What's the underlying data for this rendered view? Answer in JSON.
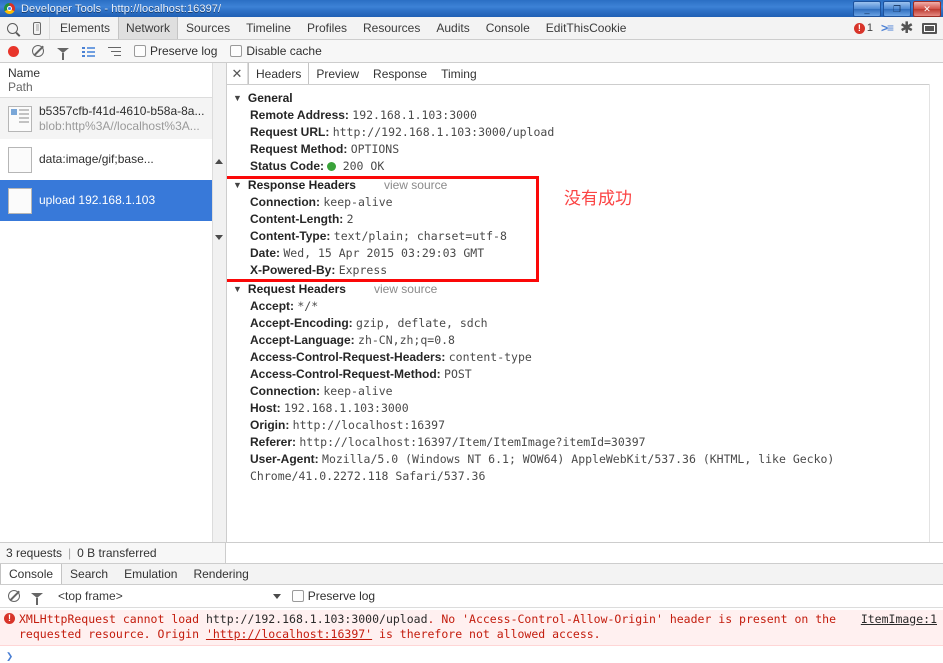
{
  "window": {
    "title": "Developer Tools - http://localhost:16397/",
    "minimize": "_",
    "maximize": "❐",
    "close": "✕"
  },
  "toolbar": {
    "search_icon": "search-icon",
    "device_icon": "device-toggle-icon",
    "panels": [
      {
        "label": "Elements",
        "selected": false
      },
      {
        "label": "Network",
        "selected": true
      },
      {
        "label": "Sources",
        "selected": false
      },
      {
        "label": "Timeline",
        "selected": false
      },
      {
        "label": "Profiles",
        "selected": false
      },
      {
        "label": "Resources",
        "selected": false
      },
      {
        "label": "Audits",
        "selected": false
      },
      {
        "label": "Console",
        "selected": false
      },
      {
        "label": "EditThisCookie",
        "selected": false
      }
    ],
    "error_count": "1",
    "drawer_toggle_icon": "console-drawer-icon",
    "settings_icon": "gear-icon",
    "dock_icon": "dock-position-icon"
  },
  "network_toolbar": {
    "record_label": "record-button",
    "clear_label": "clear-button",
    "filter_label": "filter-button",
    "large_rows_label": "use-large-rows-button",
    "group_label": "group-by-frame-button",
    "preserve_log": "Preserve log",
    "disable_cache": "Disable cache"
  },
  "request_list": {
    "header_name": "Name",
    "header_path": "Path",
    "rows": [
      {
        "name": "b5357cfb-f41d-4610-b58a-8a...",
        "path": "blob:http%3A//localhost%3A...",
        "selected": false
      },
      {
        "name": "data:image/gif;base...",
        "path": "",
        "selected": false
      },
      {
        "name": "upload",
        "path": "192.168.1.103",
        "selected": true
      }
    ]
  },
  "detail": {
    "close_label": "✕",
    "tabs": [
      {
        "label": "Headers",
        "selected": true
      },
      {
        "label": "Preview",
        "selected": false
      },
      {
        "label": "Response",
        "selected": false
      },
      {
        "label": "Timing",
        "selected": false
      }
    ],
    "sections": [
      {
        "title": "General",
        "view_source": "",
        "rows": [
          {
            "key": "Remote Address:",
            "value": "192.168.1.103:3000",
            "status": false
          },
          {
            "key": "Request URL:",
            "value": "http://192.168.1.103:3000/upload",
            "status": false
          },
          {
            "key": "Request Method:",
            "value": "OPTIONS",
            "status": false
          },
          {
            "key": "Status Code:",
            "value": "200 OK",
            "status": true
          }
        ]
      },
      {
        "title": "Response Headers",
        "view_source": "view source",
        "rows": [
          {
            "key": "Connection:",
            "value": "keep-alive",
            "status": false
          },
          {
            "key": "Content-Length:",
            "value": "2",
            "status": false
          },
          {
            "key": "Content-Type:",
            "value": "text/plain; charset=utf-8",
            "status": false
          },
          {
            "key": "Date:",
            "value": "Wed, 15 Apr 2015 03:29:03 GMT",
            "status": false
          },
          {
            "key": "X-Powered-By:",
            "value": "Express",
            "status": false
          }
        ]
      },
      {
        "title": "Request Headers",
        "view_source": "view source",
        "rows": [
          {
            "key": "Accept:",
            "value": "*/*",
            "status": false
          },
          {
            "key": "Accept-Encoding:",
            "value": "gzip, deflate, sdch",
            "status": false
          },
          {
            "key": "Accept-Language:",
            "value": "zh-CN,zh;q=0.8",
            "status": false
          },
          {
            "key": "Access-Control-Request-Headers:",
            "value": "content-type",
            "status": false
          },
          {
            "key": "Access-Control-Request-Method:",
            "value": "POST",
            "status": false
          },
          {
            "key": "Connection:",
            "value": "keep-alive",
            "status": false
          },
          {
            "key": "Host:",
            "value": "192.168.1.103:3000",
            "status": false
          },
          {
            "key": "Origin:",
            "value": "http://localhost:16397",
            "status": false
          },
          {
            "key": "Referer:",
            "value": "http://localhost:16397/Item/ItemImage?itemId=30397",
            "status": false
          },
          {
            "key": "User-Agent:",
            "value": "Mozilla/5.0 (Windows NT 6.1; WOW64) AppleWebKit/537.36 (KHTML, like Gecko) Chrome/41.0.2272.118 Safari/537.36",
            "status": false,
            "wrap": true
          }
        ]
      }
    ]
  },
  "annotation": {
    "text": "没有成功",
    "color": "#fb4444",
    "box_color": "#fb0808"
  },
  "status_bar": {
    "requests": "3 requests",
    "separator": "|",
    "transferred": "0 B transferred"
  },
  "drawer": {
    "tabs": [
      {
        "label": "Console",
        "selected": true
      },
      {
        "label": "Search",
        "selected": false
      },
      {
        "label": "Emulation",
        "selected": false
      },
      {
        "label": "Rendering",
        "selected": false
      }
    ],
    "clear_icon": "clear-console-icon",
    "filter_icon": "filter-icon",
    "context": "<top frame>",
    "preserve_log": "Preserve log",
    "messages": [
      {
        "level": "error",
        "part1": "XMLHttpRequest cannot load ",
        "part2": "http://192.168.1.103:3000/upload",
        "part3": ". No 'Access-Control-Allow-Origin' header is present on the requested resource. Origin ",
        "part4": "'http://localhost:16397'",
        "part5": " is therefore not allowed access.",
        "source": "ItemImage:1"
      }
    ],
    "prompt_caret": "❯"
  }
}
